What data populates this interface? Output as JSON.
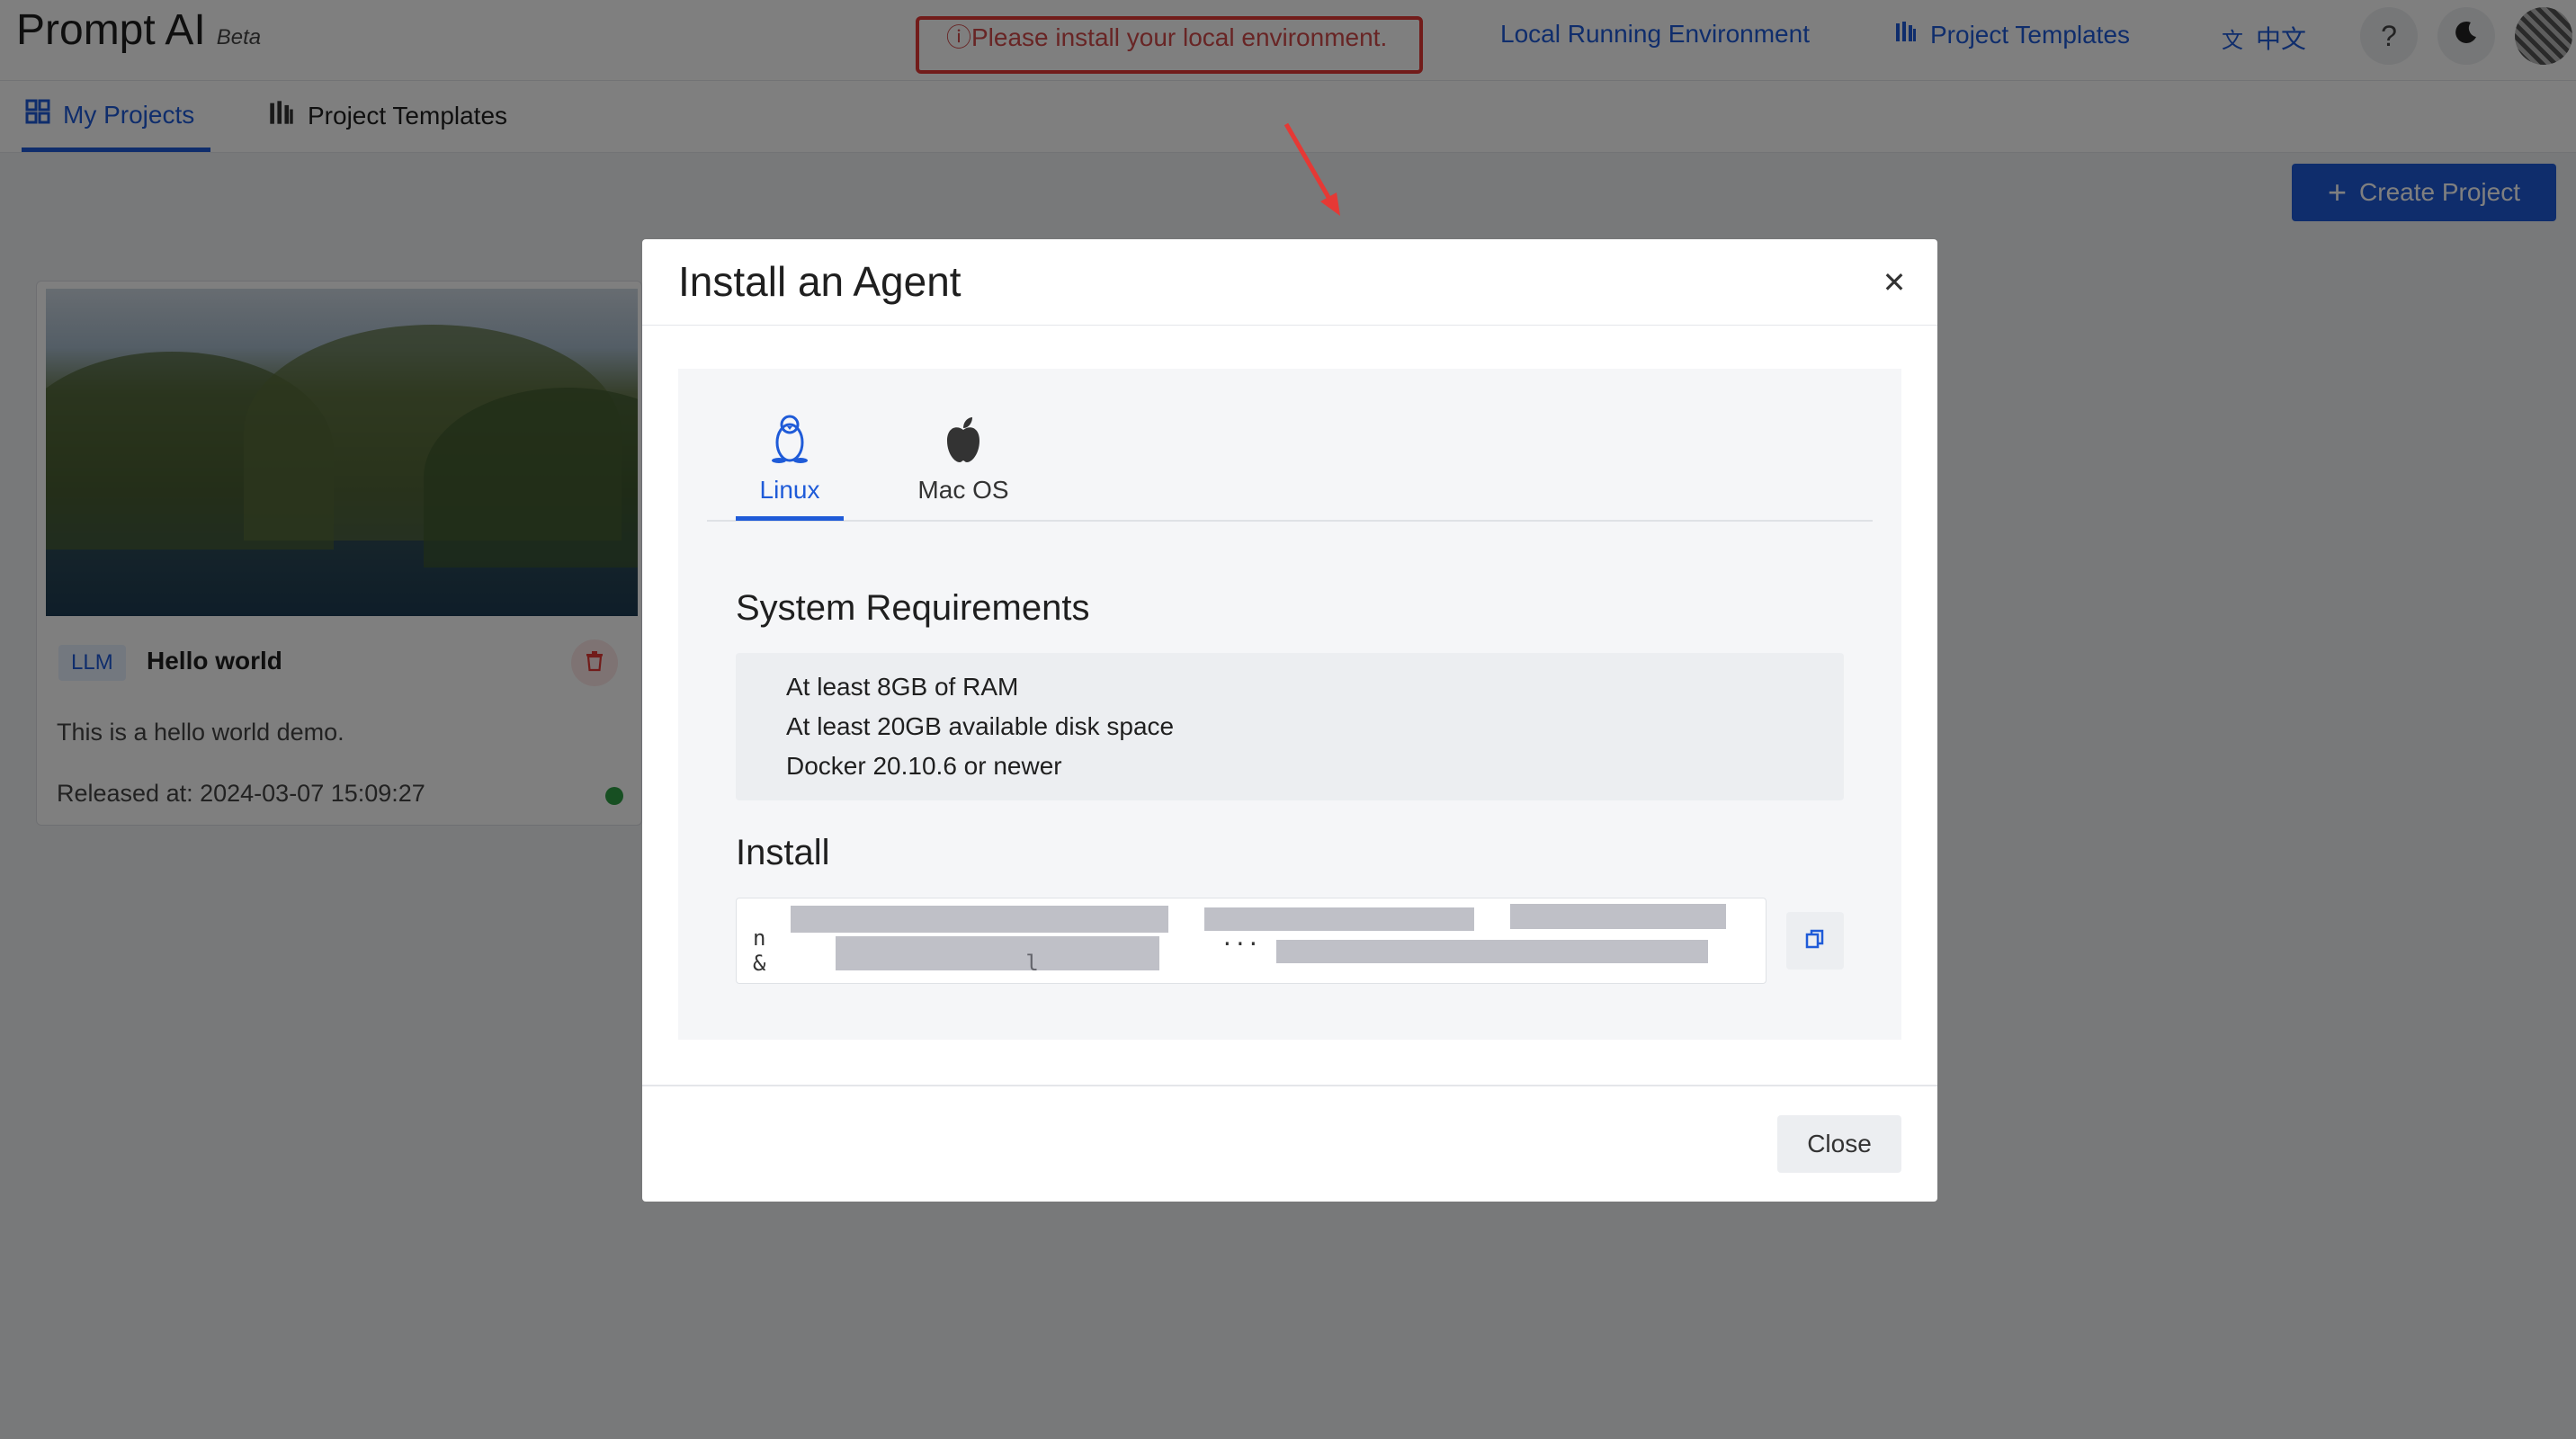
{
  "app": {
    "name": "Prompt AI",
    "badge": "Beta"
  },
  "header": {
    "notice": "ⓘPlease install your local environment.",
    "links": {
      "environment": "Local Running Environment",
      "templates": "Project Templates",
      "language": "中文"
    },
    "help_label": "?"
  },
  "subnav": {
    "tabs": [
      "My Projects",
      "Project Templates"
    ],
    "active_tab": "My Projects"
  },
  "toolbar": {
    "create_label": "Create Project"
  },
  "project_card": {
    "tag": "LLM",
    "title": "Hello world",
    "description": "This is a hello world demo.",
    "released": "Released at: 2024-03-07 15:09:27",
    "status_color": "#2e9e44"
  },
  "modal": {
    "title": "Install an Agent",
    "os_tabs": [
      "Linux",
      "Mac OS"
    ],
    "active_os": "Linux",
    "requirements_title": "System Requirements",
    "requirements": [
      "At least 8GB of RAM",
      "At least 20GB available disk space",
      "Docker 20.10.6 or newer"
    ],
    "install_title": "Install",
    "command": "n                                   ...\n&                    l",
    "close_label": "Close"
  },
  "colors": {
    "accent": "#1f5bd8",
    "notice_border": "#e53935",
    "overlay": "rgba(0,0,0,0.5)"
  }
}
